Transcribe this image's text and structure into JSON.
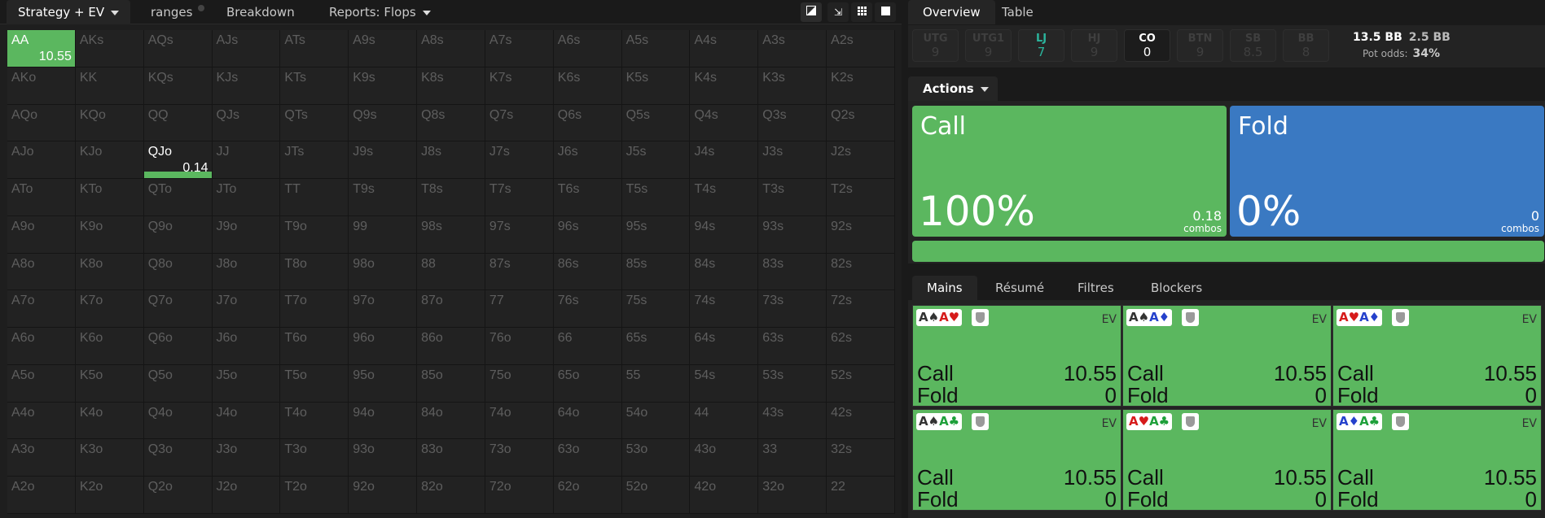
{
  "left_tabs": {
    "strategy": "Strategy + EV",
    "ranges": "ranges",
    "breakdown": "Breakdown",
    "reports": "Reports: Flops"
  },
  "toolbar_icons": [
    "contrast-icon",
    "compress-icon",
    "grid-icon",
    "square-icon"
  ],
  "grid": [
    [
      "AA",
      "AKs",
      "AQs",
      "AJs",
      "ATs",
      "A9s",
      "A8s",
      "A7s",
      "A6s",
      "A5s",
      "A4s",
      "A3s",
      "A2s"
    ],
    [
      "AKo",
      "KK",
      "KQs",
      "KJs",
      "KTs",
      "K9s",
      "K8s",
      "K7s",
      "K6s",
      "K5s",
      "K4s",
      "K3s",
      "K2s"
    ],
    [
      "AQo",
      "KQo",
      "QQ",
      "QJs",
      "QTs",
      "Q9s",
      "Q8s",
      "Q7s",
      "Q6s",
      "Q5s",
      "Q4s",
      "Q3s",
      "Q2s"
    ],
    [
      "AJo",
      "KJo",
      "QJo",
      "JJ",
      "JTs",
      "J9s",
      "J8s",
      "J7s",
      "J6s",
      "J5s",
      "J4s",
      "J3s",
      "J2s"
    ],
    [
      "ATo",
      "KTo",
      "QTo",
      "JTo",
      "TT",
      "T9s",
      "T8s",
      "T7s",
      "T6s",
      "T5s",
      "T4s",
      "T3s",
      "T2s"
    ],
    [
      "A9o",
      "K9o",
      "Q9o",
      "J9o",
      "T9o",
      "99",
      "98s",
      "97s",
      "96s",
      "95s",
      "94s",
      "93s",
      "92s"
    ],
    [
      "A8o",
      "K8o",
      "Q8o",
      "J8o",
      "T8o",
      "98o",
      "88",
      "87s",
      "86s",
      "85s",
      "84s",
      "83s",
      "82s"
    ],
    [
      "A7o",
      "K7o",
      "Q7o",
      "J7o",
      "T7o",
      "97o",
      "87o",
      "77",
      "76s",
      "75s",
      "74s",
      "73s",
      "72s"
    ],
    [
      "A6o",
      "K6o",
      "Q6o",
      "J6o",
      "T6o",
      "96o",
      "86o",
      "76o",
      "66",
      "65s",
      "64s",
      "63s",
      "62s"
    ],
    [
      "A5o",
      "K5o",
      "Q5o",
      "J5o",
      "T5o",
      "95o",
      "85o",
      "75o",
      "65o",
      "55",
      "54s",
      "53s",
      "52s"
    ],
    [
      "A4o",
      "K4o",
      "Q4o",
      "J4o",
      "T4o",
      "94o",
      "84o",
      "74o",
      "64o",
      "54o",
      "44",
      "43s",
      "42s"
    ],
    [
      "A3o",
      "K3o",
      "Q3o",
      "J3o",
      "T3o",
      "93o",
      "83o",
      "73o",
      "63o",
      "53o",
      "43o",
      "33",
      "32s"
    ],
    [
      "A2o",
      "K2o",
      "Q2o",
      "J2o",
      "T2o",
      "92o",
      "82o",
      "72o",
      "62o",
      "52o",
      "42o",
      "32o",
      "22"
    ]
  ],
  "grid_highlights": {
    "AA": {
      "ev": "10.55",
      "call_fraction": 1.0
    },
    "QJo": {
      "ev": "0.14",
      "call_fraction": 1.0
    }
  },
  "right_tabs": {
    "overview": "Overview",
    "table": "Table"
  },
  "positions": [
    {
      "name": "UTG",
      "value": "9",
      "state": "inactive"
    },
    {
      "name": "UTG1",
      "value": "9",
      "state": "inactive"
    },
    {
      "name": "LJ",
      "value": "7",
      "state": "active"
    },
    {
      "name": "HJ",
      "value": "9",
      "state": "inactive"
    },
    {
      "name": "CO",
      "value": "0",
      "state": "current"
    },
    {
      "name": "BTN",
      "value": "9",
      "state": "inactive"
    },
    {
      "name": "SB",
      "value": "8.5",
      "state": "inactive"
    },
    {
      "name": "BB",
      "value": "8",
      "state": "inactive"
    }
  ],
  "stack": "13.5 BB",
  "pot": "2.5 BB",
  "pot_odds_label": "Pot odds:",
  "pot_odds_value": "34%",
  "actions_label": "Actions",
  "actions": [
    {
      "name": "Call",
      "pct": "100%",
      "combos": "0.18",
      "combos_label": "combos",
      "color": "#5bb75f"
    },
    {
      "name": "Fold",
      "pct": "0%",
      "combos": "0",
      "combos_label": "combos",
      "color": "#3a79c2"
    }
  ],
  "frequency_bar": {
    "call_fraction": 1.0
  },
  "hand_tabs": [
    "Mains",
    "Résumé",
    "Filtres",
    "Blockers"
  ],
  "hands": [
    {
      "cards": [
        [
          "A",
          "♠",
          "sp"
        ],
        [
          "A",
          "♥",
          "ht"
        ]
      ],
      "ev_label": "EV",
      "rows": [
        [
          "Call",
          "10.55"
        ],
        [
          "Fold",
          "0"
        ]
      ]
    },
    {
      "cards": [
        [
          "A",
          "♠",
          "sp"
        ],
        [
          "A",
          "♦",
          "dm"
        ]
      ],
      "ev_label": "EV",
      "rows": [
        [
          "Call",
          "10.55"
        ],
        [
          "Fold",
          "0"
        ]
      ]
    },
    {
      "cards": [
        [
          "A",
          "♥",
          "ht"
        ],
        [
          "A",
          "♦",
          "dm"
        ]
      ],
      "ev_label": "EV",
      "rows": [
        [
          "Call",
          "10.55"
        ],
        [
          "Fold",
          "0"
        ]
      ]
    },
    {
      "cards": [
        [
          "A",
          "♠",
          "sp"
        ],
        [
          "A",
          "♣",
          "cl"
        ]
      ],
      "ev_label": "EV",
      "rows": [
        [
          "Call",
          "10.55"
        ],
        [
          "Fold",
          "0"
        ]
      ]
    },
    {
      "cards": [
        [
          "A",
          "♥",
          "ht"
        ],
        [
          "A",
          "♣",
          "cl"
        ]
      ],
      "ev_label": "EV",
      "rows": [
        [
          "Call",
          "10.55"
        ],
        [
          "Fold",
          "0"
        ]
      ]
    },
    {
      "cards": [
        [
          "A",
          "♦",
          "dm"
        ],
        [
          "A",
          "♣",
          "cl"
        ]
      ],
      "ev_label": "EV",
      "rows": [
        [
          "Call",
          "10.55"
        ],
        [
          "Fold",
          "0"
        ]
      ]
    }
  ]
}
